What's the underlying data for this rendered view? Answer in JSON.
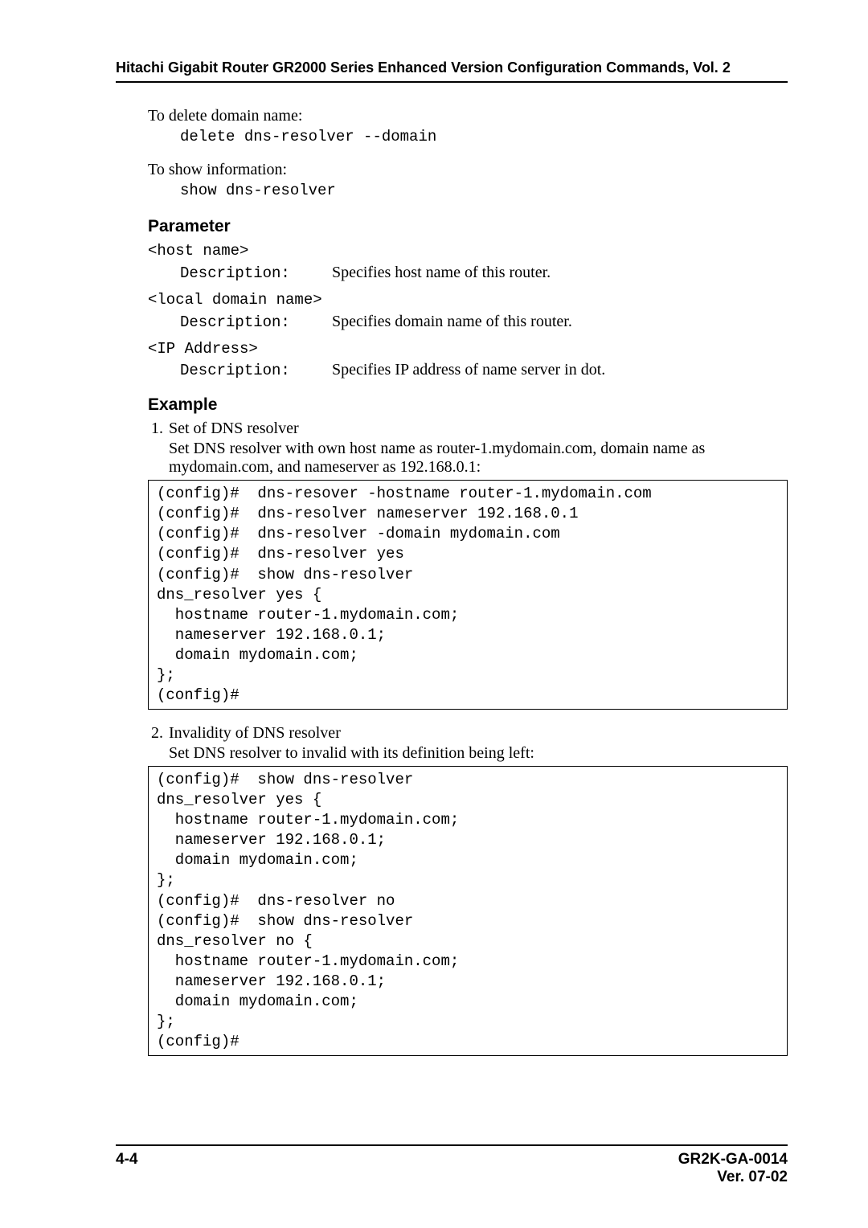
{
  "header": {
    "title": "Hitachi Gigabit Router GR2000 Series Enhanced Version Configuration Commands, Vol. 2"
  },
  "intro": {
    "delete_title": "To delete domain name:",
    "delete_cmd": "delete dns-resolver --domain",
    "show_title": "To show information:",
    "show_cmd": "show dns-resolver"
  },
  "param_section": {
    "heading": "Parameter",
    "items": [
      {
        "name": "<host name>",
        "label": "Description:",
        "desc": "Specifies host name of this router."
      },
      {
        "name": "<local domain name>",
        "label": "Description:",
        "desc": "Specifies domain name of this router."
      },
      {
        "name": "<IP Address>",
        "label": "Description:",
        "desc": "Specifies IP address of name server in dot."
      }
    ]
  },
  "example_section": {
    "heading": "Example",
    "items": [
      {
        "title": "Set of DNS resolver",
        "desc": "Set DNS resolver with own host name as router-1.mydomain.com, domain name as mydomain.com, and nameserver as 192.168.0.1:",
        "code": "(config)#  dns-resover -hostname router-1.mydomain.com\n(config)#  dns-resolver nameserver 192.168.0.1\n(config)#  dns-resolver -domain mydomain.com\n(config)#  dns-resolver yes\n(config)#  show dns-resolver\ndns_resolver yes {\n  hostname router-1.mydomain.com;\n  nameserver 192.168.0.1;\n  domain mydomain.com;\n};\n(config)#"
      },
      {
        "title": "Invalidity of DNS resolver",
        "desc": "Set DNS resolver to invalid with its definition being left:",
        "code": "(config)#  show dns-resolver\ndns_resolver yes {\n  hostname router-1.mydomain.com;\n  nameserver 192.168.0.1;\n  domain mydomain.com;\n};\n(config)#  dns-resolver no\n(config)#  show dns-resolver\ndns_resolver no {\n  hostname router-1.mydomain.com;\n  nameserver 192.168.0.1;\n  domain mydomain.com;\n};\n(config)#"
      }
    ]
  },
  "footer": {
    "left": "4-4",
    "right_line1": "GR2K-GA-0014",
    "right_line2": "Ver. 07-02"
  }
}
